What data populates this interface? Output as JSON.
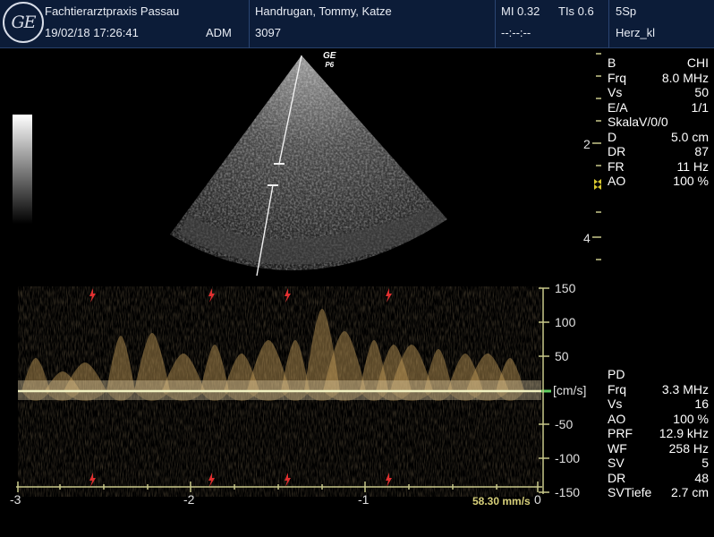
{
  "header": {
    "logo": "GE",
    "clinic": "Fachtierarztpraxis Passau",
    "datetime": "19/02/18 17:26:41",
    "operator": "ADM",
    "patient": "Handrugan, Tommy, Katze",
    "patient_id": "3097",
    "mi": "MI 0.32",
    "tis": "TIs 0.6",
    "time_placeholder": "--:--:--",
    "probe": "5Sp",
    "preset": "Herz_kl"
  },
  "bmode_params": [
    {
      "label": "B",
      "value": "CHI"
    },
    {
      "label": "Frq",
      "value": "8.0 MHz"
    },
    {
      "label": "Vs",
      "value": "50"
    },
    {
      "label": "E/A",
      "value": "1/1"
    },
    {
      "label": "SkalaV/0/0",
      "value": ""
    },
    {
      "label": "D",
      "value": "5.0 cm"
    },
    {
      "label": "DR",
      "value": "87"
    },
    {
      "label": "FR",
      "value": "11 Hz"
    },
    {
      "label": "AO",
      "value": "100 %"
    }
  ],
  "pd_params": [
    {
      "label": "PD",
      "value": ""
    },
    {
      "label": "Frq",
      "value": "3.3 MHz"
    },
    {
      "label": "Vs",
      "value": "16"
    },
    {
      "label": "AO",
      "value": "100 %"
    },
    {
      "label": "PRF",
      "value": "12.9 kHz"
    },
    {
      "label": "WF",
      "value": "258 Hz"
    },
    {
      "label": "SV",
      "value": "5"
    },
    {
      "label": "DR",
      "value": "48"
    },
    {
      "label": "SVTiefe",
      "value": "2.7 cm"
    }
  ],
  "depth_scale": {
    "labels": [
      "2",
      "4"
    ]
  },
  "probe_tag": {
    "brand": "GE",
    "mark": "P6"
  },
  "velocity_axis": {
    "unit": "[cm/s]",
    "ticks": [
      150,
      100,
      50,
      -50,
      -100,
      -150
    ]
  },
  "time_axis": {
    "ticks": [
      -3,
      -2,
      -1,
      0
    ]
  },
  "sweep_speed": "58.30 mm/s",
  "colors": {
    "header_bg": "#0c1c38",
    "doppler": "#c8a05a",
    "axis": "#c8c88a",
    "ecg_marker": "#e03030",
    "baseline": "#f0f0c0",
    "focus_marker": "#d8c830"
  },
  "ecg_markers": 4
}
